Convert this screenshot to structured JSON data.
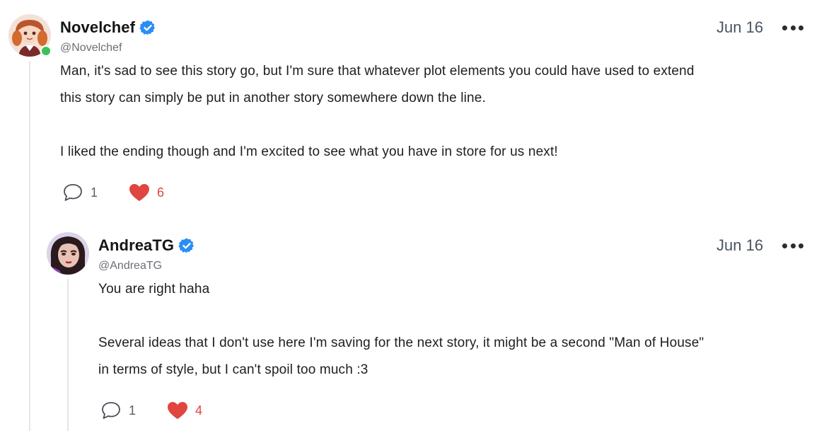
{
  "comments": [
    {
      "display_name": "Novelchef",
      "handle": "@Novelchef",
      "date": "Jun 16",
      "paragraphs": [
        "Man, it's sad to see this story go, but I'm sure that whatever plot elements you could have used to extend",
        "this story can simply be put in another story somewhere down the line.",
        "",
        "I liked the ending though and I'm excited to see what you have in store for us next!"
      ],
      "reply_count": "1",
      "like_count": "6",
      "online": true
    },
    {
      "display_name": "AndreaTG",
      "handle": "@AndreaTG",
      "date": "Jun 16",
      "paragraphs": [
        "You are right haha",
        "",
        "Several ideas that I don't use here I'm saving for the next story, it might be a second \"Man of House\"",
        "in terms of style, but I can't spoil too much :3"
      ],
      "reply_count": "1",
      "like_count": "4",
      "online": false
    }
  ],
  "colors": {
    "verified": "#2a8ef5",
    "like": "#e0453f",
    "online": "#3cc15a",
    "thread_line": "#e6e6ea"
  },
  "icons": [
    "verified-badge-icon",
    "comment-bubble-icon",
    "heart-icon",
    "more-options-icon"
  ]
}
